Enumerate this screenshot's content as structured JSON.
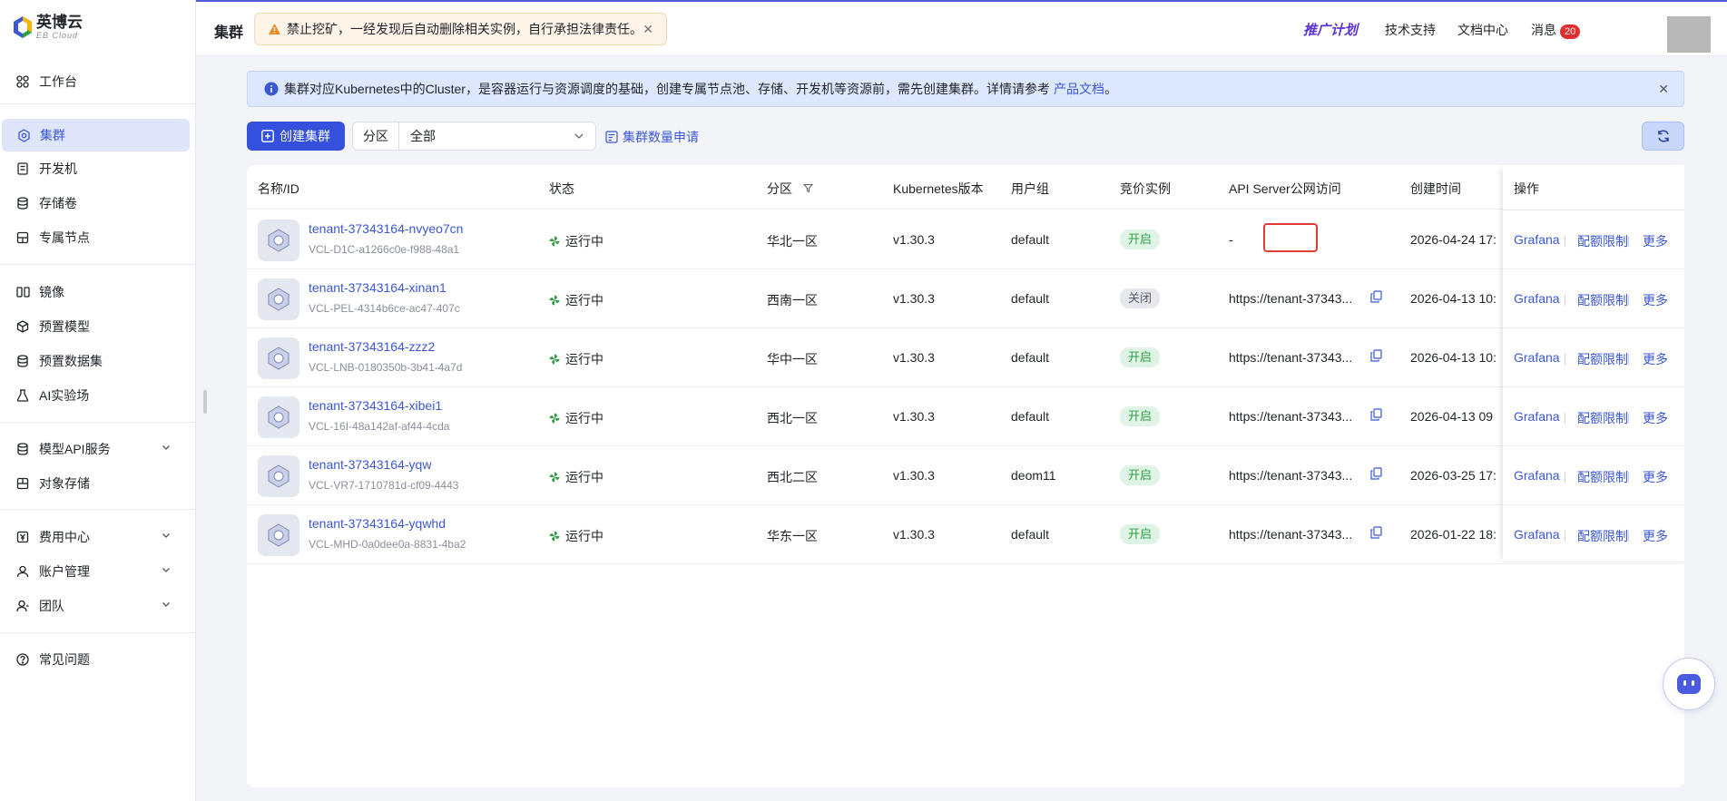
{
  "brand": {
    "name": "英博云",
    "sub": "EB Cloud"
  },
  "sidebar": {
    "items": [
      {
        "label": "工作台",
        "icon": "dashboard-icon"
      },
      {
        "label": "集群",
        "icon": "cluster-icon"
      },
      {
        "label": "开发机",
        "icon": "devbox-icon"
      },
      {
        "label": "存储卷",
        "icon": "storage-icon"
      },
      {
        "label": "专属节点",
        "icon": "node-icon"
      },
      {
        "label": "镜像",
        "icon": "image-icon"
      },
      {
        "label": "预置模型",
        "icon": "model-icon"
      },
      {
        "label": "预置数据集",
        "icon": "dataset-icon"
      },
      {
        "label": "AI实验场",
        "icon": "flask-icon"
      },
      {
        "label": "模型API服务",
        "icon": "api-icon"
      },
      {
        "label": "对象存储",
        "icon": "object-storage-icon"
      },
      {
        "label": "费用中心",
        "icon": "billing-icon"
      },
      {
        "label": "账户管理",
        "icon": "account-icon"
      },
      {
        "label": "团队",
        "icon": "team-icon"
      },
      {
        "label": "常见问题",
        "icon": "help-icon"
      }
    ]
  },
  "header": {
    "title": "集群",
    "warning": "禁止挖矿，一经发现后自动删除相关实例，自行承担法律责任。",
    "promo": "推广计划",
    "support": "技术支持",
    "docs": "文档中心",
    "messages": "消息",
    "message_count": "20"
  },
  "info": {
    "text": "集群对应Kubernetes中的Cluster，是容器运行与资源调度的基础，创建专属节点池、存储、开发机等资源前，需先创建集群。详情请参考",
    "link": "产品文档",
    "suffix": "。"
  },
  "toolbar": {
    "create": "创建集群",
    "zone_label": "分区",
    "zone_value": "全部",
    "quota": "集群数量申请"
  },
  "table": {
    "headers": {
      "name": "名称/ID",
      "status": "状态",
      "zone": "分区",
      "k8s": "Kubernetes版本",
      "group": "用户组",
      "spot": "竞价实例",
      "api": "API Server公网访问",
      "created": "创建时间",
      "ops": "操作"
    },
    "ops": {
      "grafana": "Grafana",
      "quota": "配额限制",
      "more": "更多"
    },
    "rows": [
      {
        "name": "tenant-37343164-nvyeo7cn",
        "id": "VCL-D1C-a1266c0e-f988-48a1",
        "status": "运行中",
        "zone": "华北一区",
        "k8s": "v1.30.3",
        "group": "default",
        "spot": "开启",
        "api": "-",
        "created": "2026-04-24 17:"
      },
      {
        "name": "tenant-37343164-xinan1",
        "id": "VCL-PEL-4314b6ce-ac47-407c",
        "status": "运行中",
        "zone": "西南一区",
        "k8s": "v1.30.3",
        "group": "default",
        "spot": "关闭",
        "api": "https://tenant-37343...",
        "created": "2026-04-13 10:"
      },
      {
        "name": "tenant-37343164-zzz2",
        "id": "VCL-LNB-0180350b-3b41-4a7d",
        "status": "运行中",
        "zone": "华中一区",
        "k8s": "v1.30.3",
        "group": "default",
        "spot": "开启",
        "api": "https://tenant-37343...",
        "created": "2026-04-13 10:"
      },
      {
        "name": "tenant-37343164-xibei1",
        "id": "VCL-16I-48a142af-af44-4cda",
        "status": "运行中",
        "zone": "西北一区",
        "k8s": "v1.30.3",
        "group": "default",
        "spot": "开启",
        "api": "https://tenant-37343...",
        "created": "2026-04-13 09"
      },
      {
        "name": "tenant-37343164-yqw",
        "id": "VCL-VR7-1710781d-cf09-4443",
        "status": "运行中",
        "zone": "西北二区",
        "k8s": "v1.30.3",
        "group": "deom11",
        "spot": "开启",
        "api": "https://tenant-37343...",
        "created": "2026-03-25 17:"
      },
      {
        "name": "tenant-37343164-yqwhd",
        "id": "VCL-MHD-0a0dee0a-8831-4ba2",
        "status": "运行中",
        "zone": "华东一区",
        "k8s": "v1.30.3",
        "group": "default",
        "spot": "开启",
        "api": "https://tenant-37343...",
        "created": "2026-01-22 18:"
      }
    ]
  },
  "colors": {
    "accent": "#3450dc",
    "link": "#3b57d6",
    "running": "#2ea043",
    "danger": "#e53935"
  }
}
